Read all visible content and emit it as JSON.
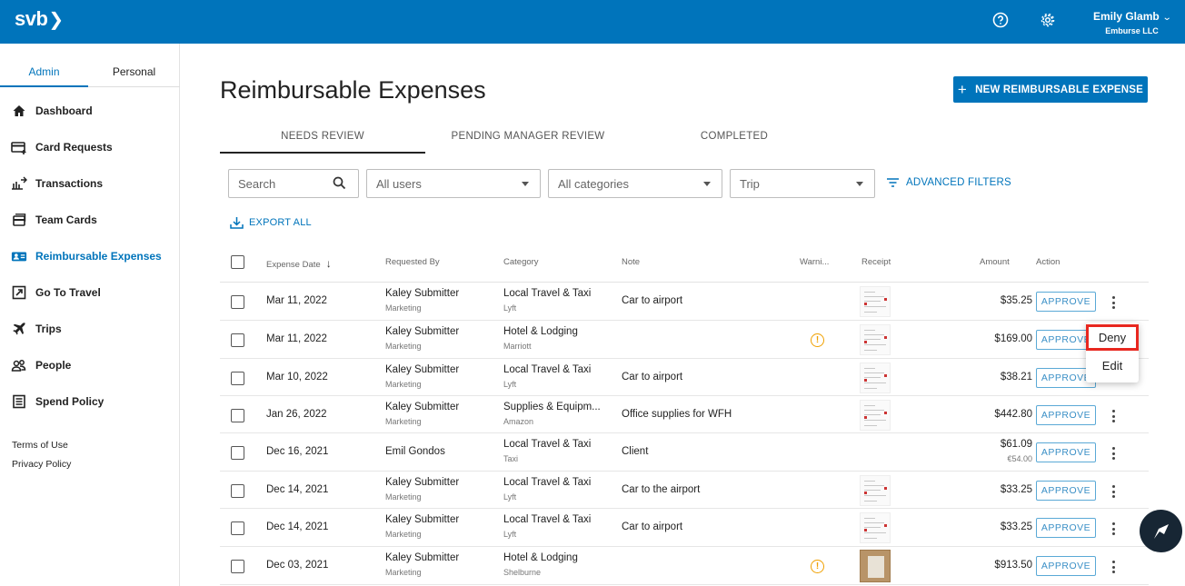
{
  "header": {
    "logo": "svb",
    "user_name": "Emily Glamb",
    "user_org": "Emburse LLC",
    "help_icon": "help-circle-icon",
    "settings_icon": "gear-icon"
  },
  "sidebar": {
    "tabs": [
      "Admin",
      "Personal"
    ],
    "items": [
      {
        "label": "Dashboard",
        "icon": "home-icon"
      },
      {
        "label": "Card Requests",
        "icon": "card-add-icon"
      },
      {
        "label": "Transactions",
        "icon": "transactions-icon"
      },
      {
        "label": "Team Cards",
        "icon": "cards-icon"
      },
      {
        "label": "Reimbursable Expenses",
        "icon": "reimburse-icon"
      },
      {
        "label": "Go To Travel",
        "icon": "external-link-icon"
      },
      {
        "label": "Trips",
        "icon": "plane-icon"
      },
      {
        "label": "People",
        "icon": "people-icon"
      },
      {
        "label": "Spend Policy",
        "icon": "policy-icon"
      }
    ],
    "footer": [
      "Terms of Use",
      "Privacy Policy"
    ]
  },
  "main": {
    "title": "Reimbursable Expenses",
    "new_button": "NEW REIMBURSABLE EXPENSE",
    "tabs": [
      "NEEDS REVIEW",
      "PENDING MANAGER REVIEW",
      "COMPLETED"
    ],
    "filters": {
      "search_placeholder": "Search",
      "users": "All users",
      "categories": "All categories",
      "trip": "Trip",
      "advanced": "ADVANCED FILTERS"
    },
    "export": "EXPORT ALL",
    "columns": [
      "Expense Date",
      "Requested By",
      "Category",
      "Note",
      "Warni...",
      "Receipt",
      "Amount",
      "Action"
    ],
    "rows": [
      {
        "date": "Mar 11, 2022",
        "name": "Kaley Submitter",
        "dept": "Marketing",
        "category": "Local Travel & Taxi",
        "vendor": "Lyft",
        "note": "Car to airport",
        "warning": false,
        "amount": "$35.25",
        "amount_sub": "",
        "action": "APPROVE"
      },
      {
        "date": "Mar 11, 2022",
        "name": "Kaley Submitter",
        "dept": "Marketing",
        "category": "Hotel & Lodging",
        "vendor": "Marriott",
        "note": "",
        "warning": true,
        "amount": "$169.00",
        "amount_sub": "",
        "action": "APPROVE"
      },
      {
        "date": "Mar 10, 2022",
        "name": "Kaley Submitter",
        "dept": "Marketing",
        "category": "Local Travel & Taxi",
        "vendor": "Lyft",
        "note": "Car to airport",
        "warning": false,
        "amount": "$38.21",
        "amount_sub": "",
        "action": "APPROVE"
      },
      {
        "date": "Jan 26, 2022",
        "name": "Kaley Submitter",
        "dept": "Marketing",
        "category": "Supplies & Equipm...",
        "vendor": "Amazon",
        "note": "Office supplies for WFH",
        "warning": false,
        "amount": "$442.80",
        "amount_sub": "",
        "action": "APPROVE"
      },
      {
        "date": "Dec 16, 2021",
        "name": "Emil Gondos",
        "dept": "",
        "category": "Local Travel & Taxi",
        "vendor": "Taxi",
        "note": "Client",
        "warning": false,
        "amount": "$61.09",
        "amount_sub": "€54.00",
        "action": "APPROVE"
      },
      {
        "date": "Dec 14, 2021",
        "name": "Kaley Submitter",
        "dept": "Marketing",
        "category": "Local Travel & Taxi",
        "vendor": "Lyft",
        "note": "Car to the airport",
        "warning": false,
        "amount": "$33.25",
        "amount_sub": "",
        "action": "APPROVE"
      },
      {
        "date": "Dec 14, 2021",
        "name": "Kaley Submitter",
        "dept": "Marketing",
        "category": "Local Travel & Taxi",
        "vendor": "Lyft",
        "note": "Car to airport",
        "warning": false,
        "amount": "$33.25",
        "amount_sub": "",
        "action": "APPROVE"
      },
      {
        "date": "Dec 03, 2021",
        "name": "Kaley Submitter",
        "dept": "Marketing",
        "category": "Hotel & Lodging",
        "vendor": "Shelburne",
        "note": "",
        "warning": true,
        "amount": "$913.50",
        "amount_sub": "",
        "action": "APPROVE"
      }
    ],
    "context_menu": [
      "Deny",
      "Edit"
    ]
  },
  "colors": {
    "brand": "#0074bb",
    "warning": "#f0a000",
    "highlight": "#e8271f"
  }
}
